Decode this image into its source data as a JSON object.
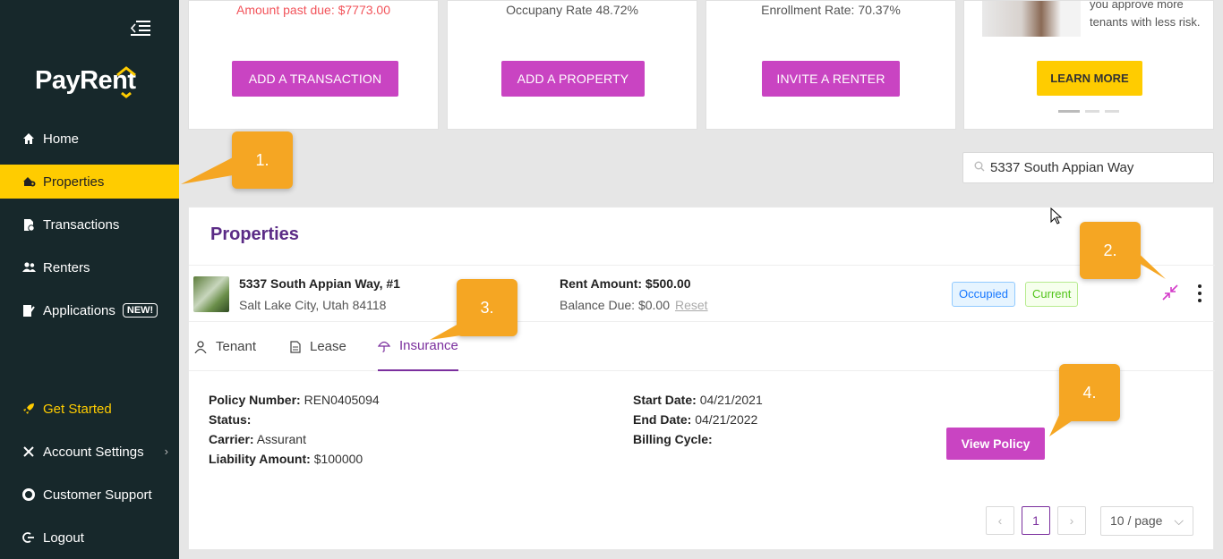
{
  "app": {
    "logo": "PayRent"
  },
  "sidebar": {
    "items": [
      {
        "label": "Home",
        "icon": "home-icon"
      },
      {
        "label": "Properties",
        "icon": "properties-icon"
      },
      {
        "label": "Transactions",
        "icon": "transactions-icon"
      },
      {
        "label": "Renters",
        "icon": "renters-icon"
      },
      {
        "label": "Applications",
        "icon": "applications-icon",
        "badge": "NEW!"
      },
      {
        "label": "Get Started",
        "icon": "rocket-icon"
      },
      {
        "label": "Account Settings",
        "icon": "settings-icon"
      },
      {
        "label": "Customer Support",
        "icon": "support-icon"
      },
      {
        "label": "Logout",
        "icon": "logout-icon"
      }
    ]
  },
  "cards": [
    {
      "stat": "Amount past due: $7773.00",
      "button": "ADD A TRANSACTION"
    },
    {
      "stat": "Occupany Rate 48.72%",
      "button": "ADD A PROPERTY"
    },
    {
      "stat": "Enrollment Rate: 70.37%",
      "button": "INVITE A RENTER"
    },
    {
      "text": "you approve more tenants with less risk.",
      "button": "LEARN MORE"
    }
  ],
  "callouts": [
    "1.",
    "2.",
    "3.",
    "4."
  ],
  "search": {
    "value": "5337 South Appian Way"
  },
  "properties": {
    "title": "Properties",
    "row": {
      "address": "5337 South Appian Way, #1",
      "city": "Salt Lake City, Utah 84118",
      "rent": "Rent Amount: $500.00",
      "balance": "Balance Due: $0.00",
      "reset": "Reset",
      "tag_status": "Occupied",
      "tag_lease": "Current"
    },
    "tabs": [
      {
        "label": "Tenant"
      },
      {
        "label": "Lease"
      },
      {
        "label": "Insurance"
      }
    ],
    "insurance": {
      "policy_number_label": "Policy Number:",
      "policy_number": "REN0405094",
      "status_label": "Status:",
      "carrier_label": "Carrier:",
      "carrier": "Assurant",
      "liability_label": "Liability Amount:",
      "liability": "$100000",
      "start_label": "Start Date:",
      "start": "04/21/2021",
      "end_label": "End Date:",
      "end": "04/21/2022",
      "billing_label": "Billing Cycle:",
      "view_button": "View Policy"
    },
    "pagination": {
      "current": "1",
      "page_size": "10 / page"
    }
  },
  "colors": {
    "sidebar": "#17282b",
    "active": "#ffcc00",
    "purple": "#c944c2",
    "title": "#5b2b86",
    "callout": "#f5a623"
  }
}
